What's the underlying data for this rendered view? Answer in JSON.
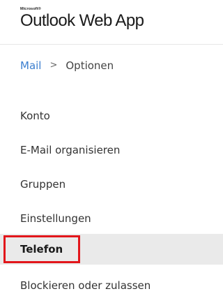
{
  "header": {
    "brand_small": "Microsoft®",
    "app_title": "Outlook Web App"
  },
  "breadcrumb": {
    "parent": "Mail",
    "separator": ">",
    "current": "Optionen"
  },
  "nav": {
    "items": [
      {
        "label": "Konto",
        "active": false
      },
      {
        "label": "E-Mail organisieren",
        "active": false
      },
      {
        "label": "Gruppen",
        "active": false
      },
      {
        "label": "Einstellungen",
        "active": false
      },
      {
        "label": "Telefon",
        "active": true,
        "highlighted": true
      },
      {
        "label": "Blockieren oder zulassen",
        "active": false
      }
    ]
  },
  "colors": {
    "link": "#3b7ecf",
    "active_bg": "#eaeaea",
    "highlight_border": "#e2161b"
  }
}
